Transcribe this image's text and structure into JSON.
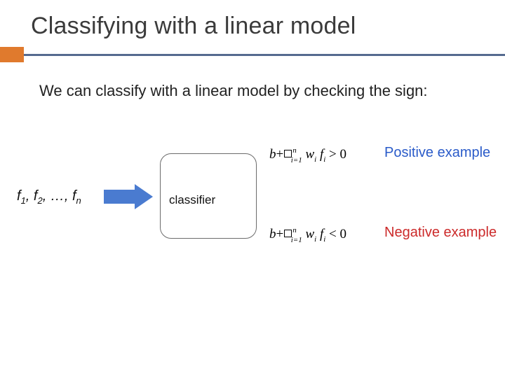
{
  "title": "Classifying with a linear model",
  "body": "We can classify with a linear model by checking the sign:",
  "diagram": {
    "input_prefix": "f",
    "classifier_label": "classifier",
    "positive_label": "Positive example",
    "negative_label": "Negative example",
    "formula": {
      "bias": "b",
      "weight": "w",
      "feature": "f",
      "idx": "i",
      "to": "n",
      "from": "i=1",
      "gt": "> 0",
      "lt": "< 0"
    }
  }
}
